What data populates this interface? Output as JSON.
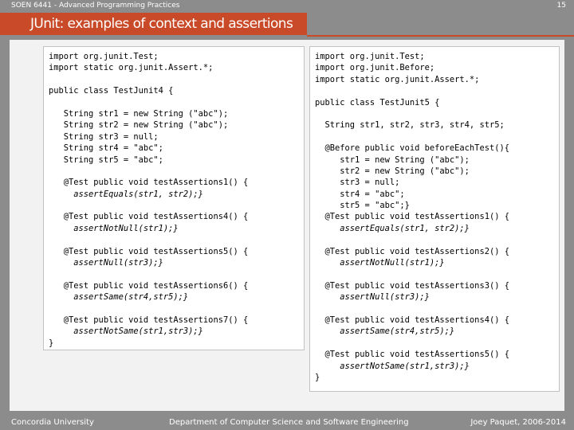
{
  "header": {
    "course": "SOEN 6441 - Advanced Programming Practices",
    "page_number": "15"
  },
  "slide": {
    "title": "JUnit: examples of context and assertions"
  },
  "left_code": [
    {
      "text": "import org.junit.Test;",
      "italic": false
    },
    {
      "text": "import static org.junit.Assert.*;",
      "italic": false
    },
    {
      "text": "",
      "italic": false
    },
    {
      "text": "public class TestJunit4 {",
      "italic": false
    },
    {
      "text": "",
      "italic": false
    },
    {
      "text": "   String str1 = new String (\"abc\");",
      "italic": false
    },
    {
      "text": "   String str2 = new String (\"abc\");",
      "italic": false
    },
    {
      "text": "   String str3 = null;",
      "italic": false
    },
    {
      "text": "   String str4 = \"abc\";",
      "italic": false
    },
    {
      "text": "   String str5 = \"abc\";",
      "italic": false
    },
    {
      "text": "",
      "italic": false
    },
    {
      "text": "   @Test public void testAssertions1() {",
      "italic": false
    },
    {
      "text": "     assertEquals(str1, str2);}",
      "italic": true
    },
    {
      "text": "",
      "italic": false
    },
    {
      "text": "   @Test public void testAssertions4() {",
      "italic": false
    },
    {
      "text": "     assertNotNull(str1);}",
      "italic": true
    },
    {
      "text": "",
      "italic": false
    },
    {
      "text": "   @Test public void testAssertions5() {",
      "italic": false
    },
    {
      "text": "     assertNull(str3);}",
      "italic": true
    },
    {
      "text": "",
      "italic": false
    },
    {
      "text": "   @Test public void testAssertions6() {",
      "italic": false
    },
    {
      "text": "     assertSame(str4,str5);}",
      "italic": true
    },
    {
      "text": "",
      "italic": false
    },
    {
      "text": "   @Test public void testAssertions7() {",
      "italic": false
    },
    {
      "text": "     assertNotSame(str1,str3);}",
      "italic": true
    },
    {
      "text": "}",
      "italic": false
    }
  ],
  "right_code": [
    {
      "text": "import org.junit.Test;",
      "italic": false
    },
    {
      "text": "import org.junit.Before;",
      "italic": false
    },
    {
      "text": "import static org.junit.Assert.*;",
      "italic": false
    },
    {
      "text": "",
      "italic": false
    },
    {
      "text": "public class TestJunit5 {",
      "italic": false
    },
    {
      "text": "",
      "italic": false
    },
    {
      "text": "  String str1, str2, str3, str4, str5;",
      "italic": false
    },
    {
      "text": "",
      "italic": false
    },
    {
      "text": "  @Before public void beforeEachTest(){",
      "italic": false
    },
    {
      "text": "     str1 = new String (\"abc\");",
      "italic": false
    },
    {
      "text": "     str2 = new String (\"abc\");",
      "italic": false
    },
    {
      "text": "     str3 = null;",
      "italic": false
    },
    {
      "text": "     str4 = \"abc\";",
      "italic": false
    },
    {
      "text": "     str5 = \"abc\";}",
      "italic": false
    },
    {
      "text": "  @Test public void testAssertions1() {",
      "italic": false
    },
    {
      "text": "     assertEquals(str1, str2);}",
      "italic": true
    },
    {
      "text": "",
      "italic": false
    },
    {
      "text": "  @Test public void testAssertions2() {",
      "italic": false
    },
    {
      "text": "     assertNotNull(str1);}",
      "italic": true
    },
    {
      "text": "",
      "italic": false
    },
    {
      "text": "  @Test public void testAssertions3() {",
      "italic": false
    },
    {
      "text": "     assertNull(str3);}",
      "italic": true
    },
    {
      "text": "",
      "italic": false
    },
    {
      "text": "  @Test public void testAssertions4() {",
      "italic": false
    },
    {
      "text": "     assertSame(str4,str5);}",
      "italic": true
    },
    {
      "text": "",
      "italic": false
    },
    {
      "text": "  @Test public void testAssertions5() {",
      "italic": false
    },
    {
      "text": "     assertNotSame(str1,str3);}",
      "italic": true
    },
    {
      "text": "}",
      "italic": false
    }
  ],
  "footer": {
    "left": "Concordia University",
    "center": "Department of Computer Science and Software Engineering",
    "right": "Joey Paquet, 2006-2014"
  }
}
